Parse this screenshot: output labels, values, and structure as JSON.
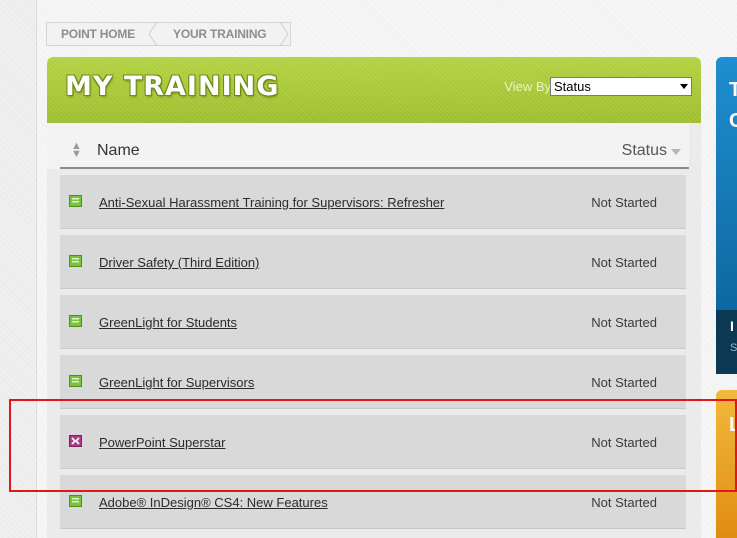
{
  "breadcrumb": {
    "items": [
      "POINT HOME",
      "YOUR TRAINING"
    ]
  },
  "panel": {
    "title": "MY TRAINING",
    "view_by_label": "View By",
    "view_by_value": "Status",
    "columns": {
      "name": "Name",
      "status": "Status"
    },
    "rows": [
      {
        "name": "Anti-Sexual Harassment Training for Supervisors: Refresher",
        "status": "Not Started",
        "icon": "course-book-icon"
      },
      {
        "name": "Driver Safety (Third Edition)",
        "status": "Not Started",
        "icon": "course-book-icon"
      },
      {
        "name": "GreenLight for Students",
        "status": "Not Started",
        "icon": "course-book-icon"
      },
      {
        "name": "GreenLight for Supervisors",
        "status": "Not Started",
        "icon": "course-book-icon"
      },
      {
        "name": "PowerPoint Superstar",
        "status": "Not Started",
        "icon": "puzzle-icon"
      },
      {
        "name": "Adobe® InDesign® CS4: New Features",
        "status": "Not Started",
        "icon": "course-book-icon"
      }
    ]
  },
  "side_panels": {
    "blue_chars": [
      "T",
      "C",
      "I",
      "S"
    ],
    "orange_chars": [
      "L"
    ]
  },
  "colors": {
    "header_green": "#a7c734",
    "highlight_red": "#e0161b",
    "side_blue": "#1e8fd0",
    "side_orange": "#f2b93c"
  }
}
